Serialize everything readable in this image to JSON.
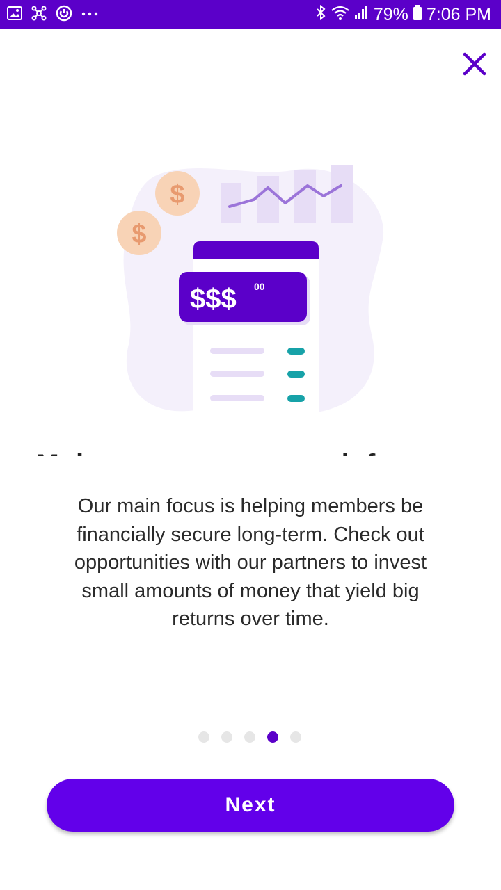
{
  "status_bar": {
    "battery": "79%",
    "time": "7:06 PM",
    "left_icons": [
      "gallery-icon",
      "network-icon",
      "sync-icon",
      "more-dots-icon"
    ],
    "right_icons": [
      "bluetooth-icon",
      "wifi-icon",
      "signal-icon",
      "battery-icon"
    ]
  },
  "illustration": {
    "amount_label": "$$$",
    "cents_label": "00",
    "coin_symbol": "$"
  },
  "onboarding": {
    "heading": "Make your money work for you",
    "body": "Our main focus is helping members be financially secure long-term. Check out opportunities with our partners to invest small amounts of money that yield big returns over time.",
    "page_count": 5,
    "current_page": 4,
    "next_label": "Next"
  },
  "colors": {
    "brand": "#5b00c9",
    "button": "#6200ea",
    "coin": "#f6c9a8",
    "teal": "#17a2a8"
  }
}
